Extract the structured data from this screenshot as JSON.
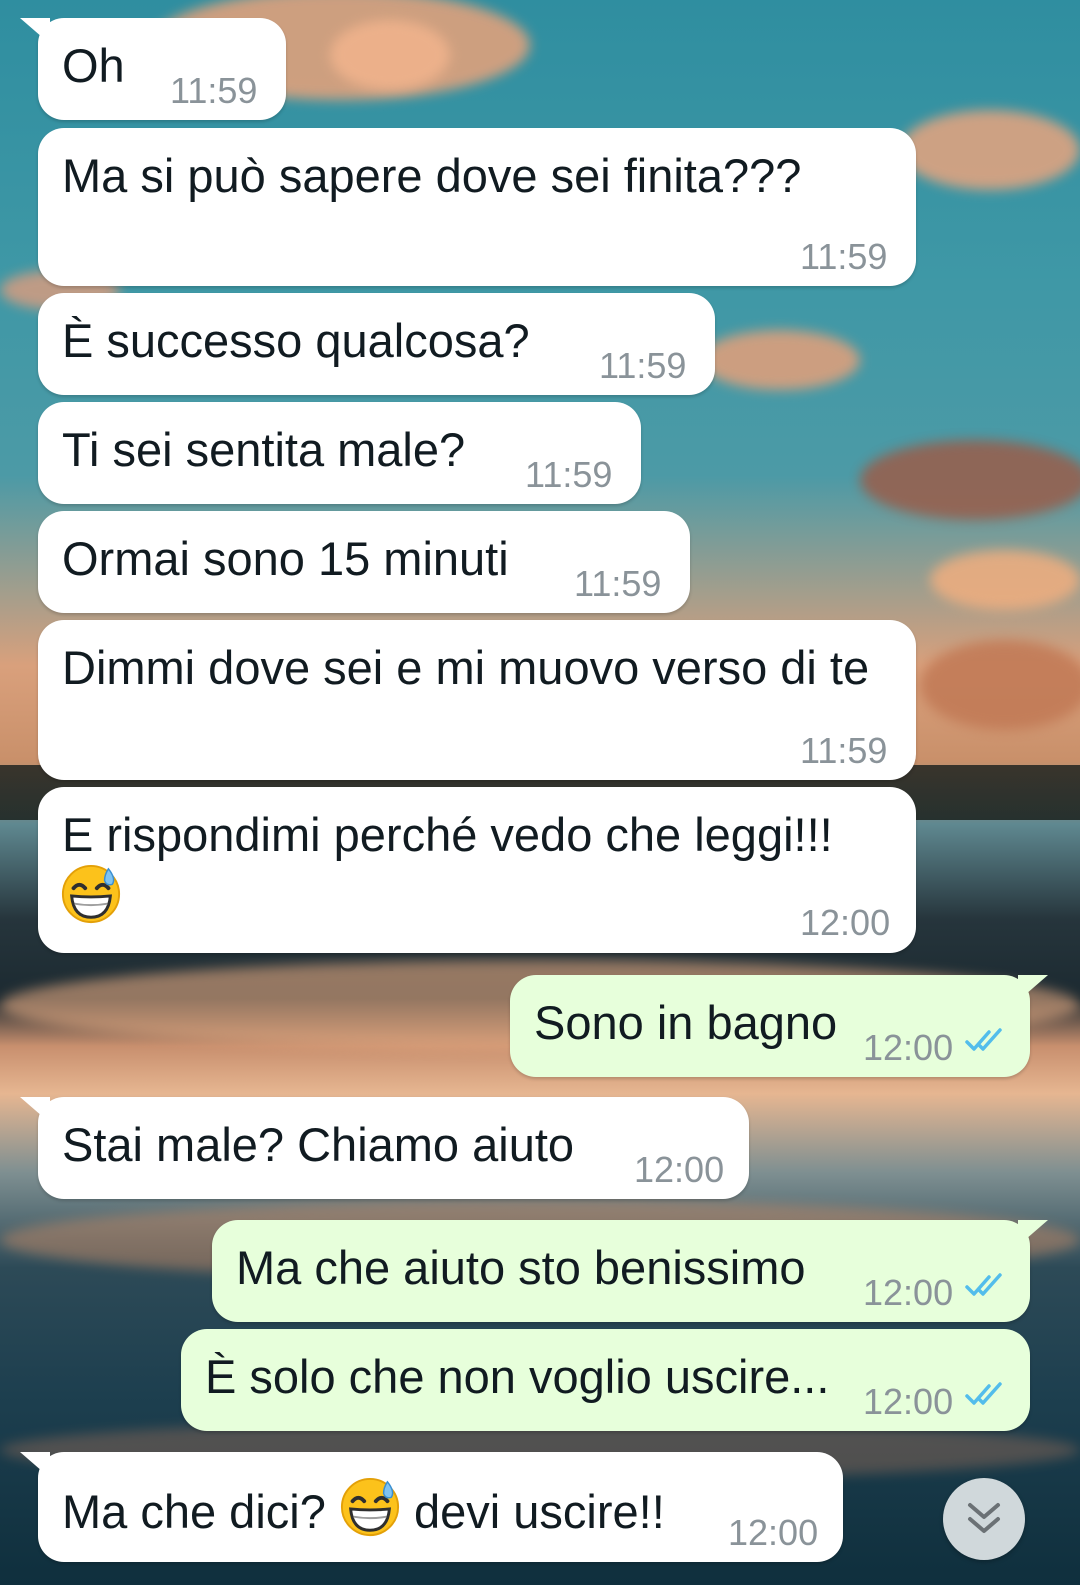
{
  "chat": {
    "messages": [
      {
        "direction": "in",
        "text": "Oh",
        "time": "11:59"
      },
      {
        "direction": "in",
        "text": "Ma si può sapere dove sei finita???",
        "time": "11:59"
      },
      {
        "direction": "in",
        "text": "È successo qualcosa?",
        "time": "11:59"
      },
      {
        "direction": "in",
        "text": "Ti sei sentita male?",
        "time": "11:59"
      },
      {
        "direction": "in",
        "text": "Ormai sono 15 minuti",
        "time": "11:59"
      },
      {
        "direction": "in",
        "text": "Dimmi dove sei e mi muovo verso di te",
        "time": "11:59"
      },
      {
        "direction": "in",
        "text": "E rispondimi perché vedo che leggi!!!",
        "time": "12:00",
        "emoji": "grinning-face-with-sweat"
      },
      {
        "direction": "out",
        "text": "Sono in bagno",
        "time": "12:00",
        "status": "read"
      },
      {
        "direction": "in",
        "text": "Stai male? Chiamo aiuto",
        "time": "12:00"
      },
      {
        "direction": "out",
        "text": "Ma che aiuto sto benissimo",
        "time": "12:00",
        "status": "read"
      },
      {
        "direction": "out",
        "text": "È solo che non voglio uscire...",
        "time": "12:00",
        "status": "read"
      },
      {
        "direction": "in",
        "text_before_emoji": "Ma che dici?",
        "text_after_emoji": "devi uscire!!",
        "time": "12:00",
        "emoji": "grinning-face-with-sweat"
      }
    ]
  },
  "icons": {
    "read_ticks": "double-check-icon",
    "emoji": "grinning-face-with-sweat-emoji",
    "scroll": "chevron-double-down-icon"
  },
  "colors": {
    "incoming_bubble": "#ffffff",
    "outgoing_bubble": "#e7ffdb",
    "read_ticks": "#53bdeb",
    "timestamp": "#8a9399"
  }
}
